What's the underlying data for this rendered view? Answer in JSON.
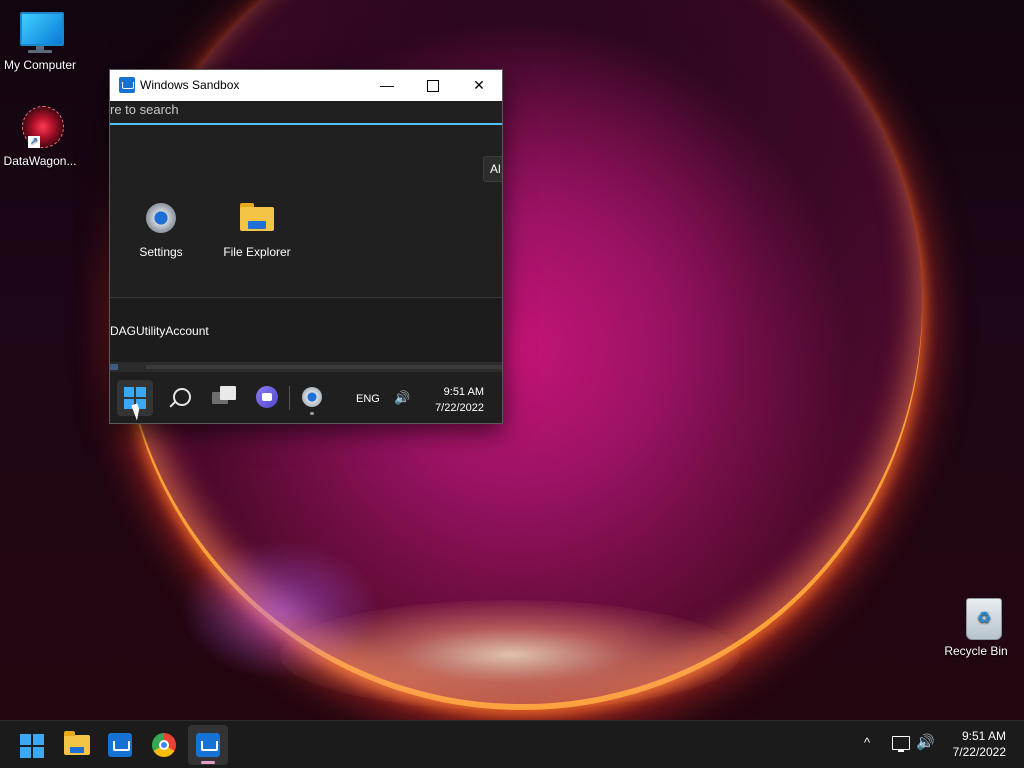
{
  "desktop": {
    "icons": [
      {
        "label": "My Computer"
      },
      {
        "label": "DataWagon..."
      },
      {
        "label": "Recycle Bin"
      }
    ]
  },
  "sandbox": {
    "title": "Windows Sandbox",
    "controls": {
      "minimize": "—",
      "close": "✕"
    },
    "search_placeholder": "re to search",
    "all_button": "Al",
    "pinned": [
      {
        "label": "Settings",
        "icon": "settings-gear-icon"
      },
      {
        "label": "File Explorer",
        "icon": "folder-icon"
      }
    ],
    "user": "DAGUtilityAccount",
    "taskbar": {
      "language": "ENG",
      "volume_glyph": "🔊",
      "time": "9:51 AM",
      "date": "7/22/2022"
    }
  },
  "taskbar": {
    "apps": [
      "start",
      "file-explorer",
      "windows-sandbox",
      "chrome",
      "windows-sandbox-active"
    ],
    "tray": {
      "chevron": "^",
      "volume_glyph": "🔊",
      "time": "9:51 AM",
      "date": "7/22/2022"
    }
  },
  "colors": {
    "accent": "#4cc2ff",
    "windows_blue": "#3aa8f2",
    "taskbar_bg": "#1b1b1b"
  }
}
